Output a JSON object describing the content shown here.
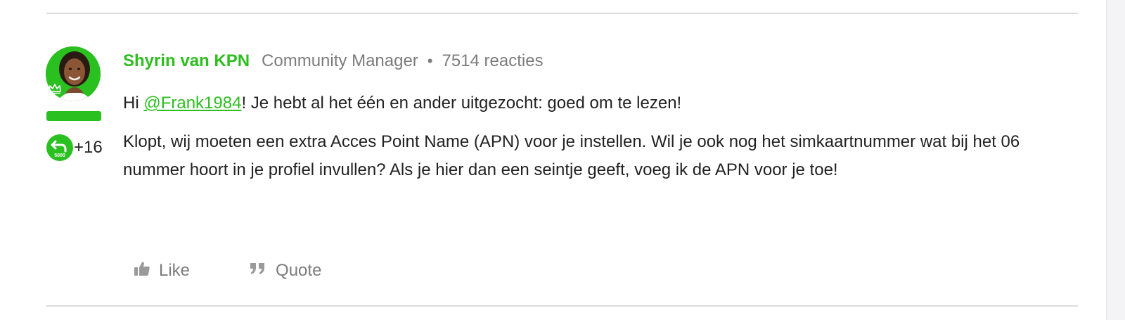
{
  "post": {
    "author": "Shyrin van KPN",
    "role": "Community Manager",
    "separator": "•",
    "replies": "7514 reacties",
    "badge": {
      "label": "5000",
      "count": "+16"
    },
    "body": {
      "p1_before": "Hi ",
      "mention": "@Frank1984",
      "p1_after": "! Je hebt al het één en ander uitgezocht: goed om te lezen!",
      "p2": "Klopt, wij moeten een extra Acces Point Name (APN) voor je instellen. Wil je ook nog het simkaartnummer wat bij het 06 nummer hoort in je profiel invullen? Als je hier dan een seintje geeft, voeg ik de APN voor je toe!"
    },
    "actions": {
      "like_label": "Like",
      "quote_label": "Quote"
    }
  },
  "colors": {
    "brand_green": "#2dbe1f",
    "muted_text": "#7c7c7c",
    "body_text": "#222222"
  },
  "icons": {
    "like": "thumbs-up-icon",
    "quote": "quote-icon",
    "badge": "reply-arrow-icon",
    "crown": "crown-icon"
  }
}
